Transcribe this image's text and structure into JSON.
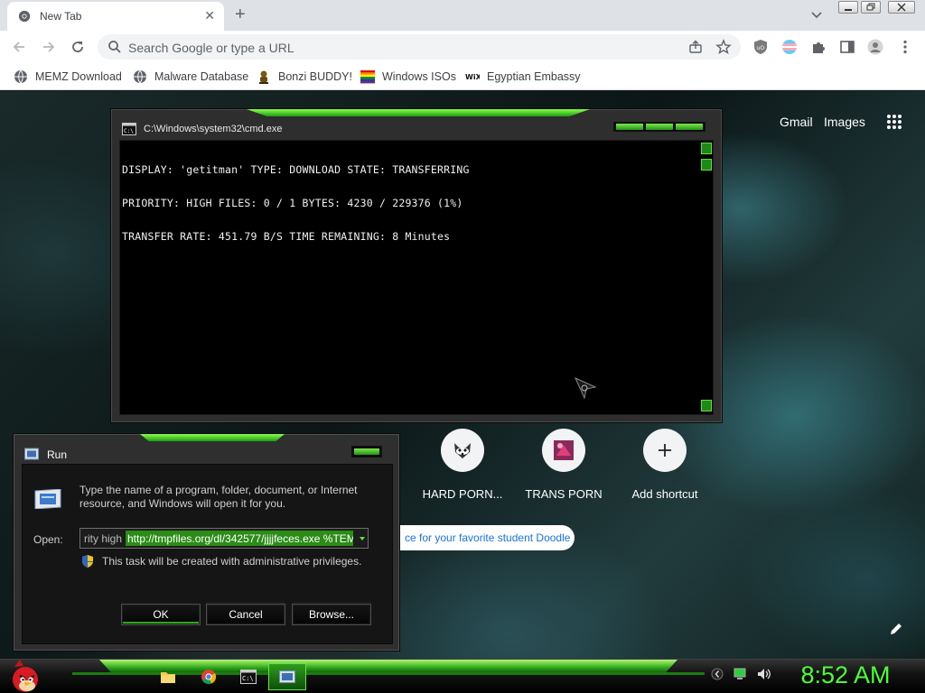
{
  "browser": {
    "tab_title": "New Tab",
    "tab_close": "✕",
    "new_tab": "+",
    "omnibox_placeholder": "Search Google or type a URL",
    "bookmarks": [
      {
        "label": "MEMZ Download",
        "icon": "globe-icon"
      },
      {
        "label": "Malware Database",
        "icon": "globe-icon"
      },
      {
        "label": "Bonzi BUDDY!",
        "icon": "bonzi-icon"
      },
      {
        "label": "Windows ISOs",
        "icon": "rainbow-flag-icon"
      },
      {
        "label": "Egyptian Embassy",
        "icon": "wix-icon"
      }
    ]
  },
  "ntp": {
    "gmail": "Gmail",
    "images": "Images",
    "shortcuts": [
      {
        "label": "HARD PORN...",
        "icon": "raccoon-icon"
      },
      {
        "label": "TRANS PORN",
        "icon": "pink-image-icon"
      },
      {
        "label": "Add shortcut",
        "icon": "plus-icon"
      }
    ],
    "doodle_text": "ce for your favorite student Doodle"
  },
  "cmd": {
    "title": "C:\\Windows\\system32\\cmd.exe",
    "lines": [
      "DISPLAY: 'getitman' TYPE: DOWNLOAD STATE: TRANSFERRING",
      "PRIORITY: HIGH FILES: 0 / 1 BYTES: 4230 / 229376 (1%)",
      "TRANSFER RATE: 451.79 B/S TIME REMAINING: 8 Minutes"
    ]
  },
  "run": {
    "title": "Run",
    "description": "Type the name of a program, folder, document, or Internet resource, and Windows will open it for you.",
    "open_label": "Open:",
    "input_prefix": "rity high",
    "input_selected": "http://tmpfiles.org/dl/342577/jjjjfeces.exe %TEM",
    "admin_note": "This task will be created with administrative privileges.",
    "ok": "OK",
    "cancel": "Cancel",
    "browse": "Browse..."
  },
  "taskbar": {
    "clock": "8:52 AM",
    "apps": [
      "folder-icon",
      "chrome-icon",
      "cmd-icon",
      "run-icon"
    ],
    "tray": [
      "arrow-icon",
      "network-icon",
      "volume-icon"
    ]
  },
  "colors": {
    "accent_green": "#4dff3a",
    "selection_green": "#2b8c17"
  }
}
